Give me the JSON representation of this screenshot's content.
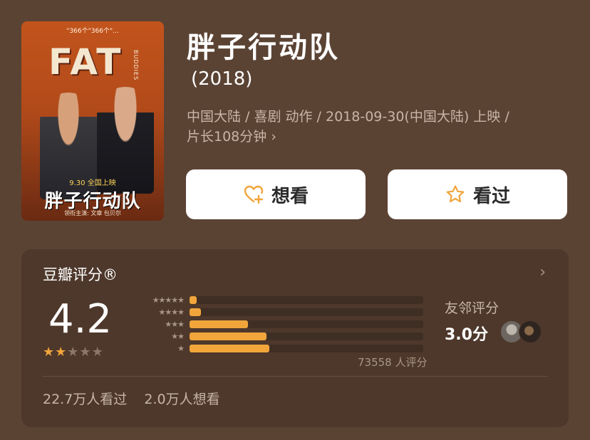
{
  "poster": {
    "top_text": "\"366个\"366个\"...",
    "logo": "FAT",
    "side_text": "BUDDIES",
    "date": "9.30 全国上映",
    "title": "胖子行动队",
    "credits": "领衔主演: 文章 包贝尔"
  },
  "movie": {
    "title": "胖子行动队",
    "year": "(2018)",
    "meta_line1": "中国大陆 / 喜剧 动作 / 2018-09-30(中国大陆) 上映 /",
    "meta_line2": "片长108分钟",
    "meta_chevron": "›"
  },
  "actions": {
    "want_label": "想看",
    "seen_label": "看过"
  },
  "rating": {
    "title": "豆瓣评分®",
    "chevron": "›",
    "score": "4.2",
    "stars_full": 2,
    "stars_total": 5,
    "distribution": [
      {
        "stars": "★★★★★",
        "percent": 3
      },
      {
        "stars": "★★★★",
        "percent": 5
      },
      {
        "stars": "★★★",
        "percent": 25
      },
      {
        "stars": "★★",
        "percent": 33
      },
      {
        "stars": "★",
        "percent": 34
      }
    ],
    "votes": "73558 人评分",
    "friend_label": "友邻评分",
    "friend_score": "3.0分"
  },
  "stats": {
    "seen": "22.7万人看过",
    "want": "2.0万人想看"
  },
  "colors": {
    "background": "#5b4334",
    "card": "#4e382b",
    "accent": "#f1a53b"
  }
}
